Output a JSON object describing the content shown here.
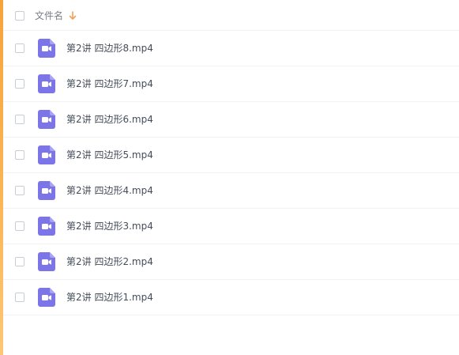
{
  "header": {
    "column_label": "文件名",
    "sort_direction": "descending",
    "sort_color": "#f0a05a"
  },
  "files": [
    {
      "name": "第2讲 四边形8.mp4",
      "icon": "video-file-icon"
    },
    {
      "name": "第2讲 四边形7.mp4",
      "icon": "video-file-icon"
    },
    {
      "name": "第2讲 四边形6.mp4",
      "icon": "video-file-icon"
    },
    {
      "name": "第2讲 四边形5.mp4",
      "icon": "video-file-icon"
    },
    {
      "name": "第2讲 四边形4.mp4",
      "icon": "video-file-icon"
    },
    {
      "name": "第2讲 四边形3.mp4",
      "icon": "video-file-icon"
    },
    {
      "name": "第2讲 四边形2.mp4",
      "icon": "video-file-icon"
    },
    {
      "name": "第2讲 四边形1.mp4",
      "icon": "video-file-icon"
    }
  ],
  "colors": {
    "video_icon": "#7c75e8",
    "accent_edge": "#f7a33a"
  }
}
